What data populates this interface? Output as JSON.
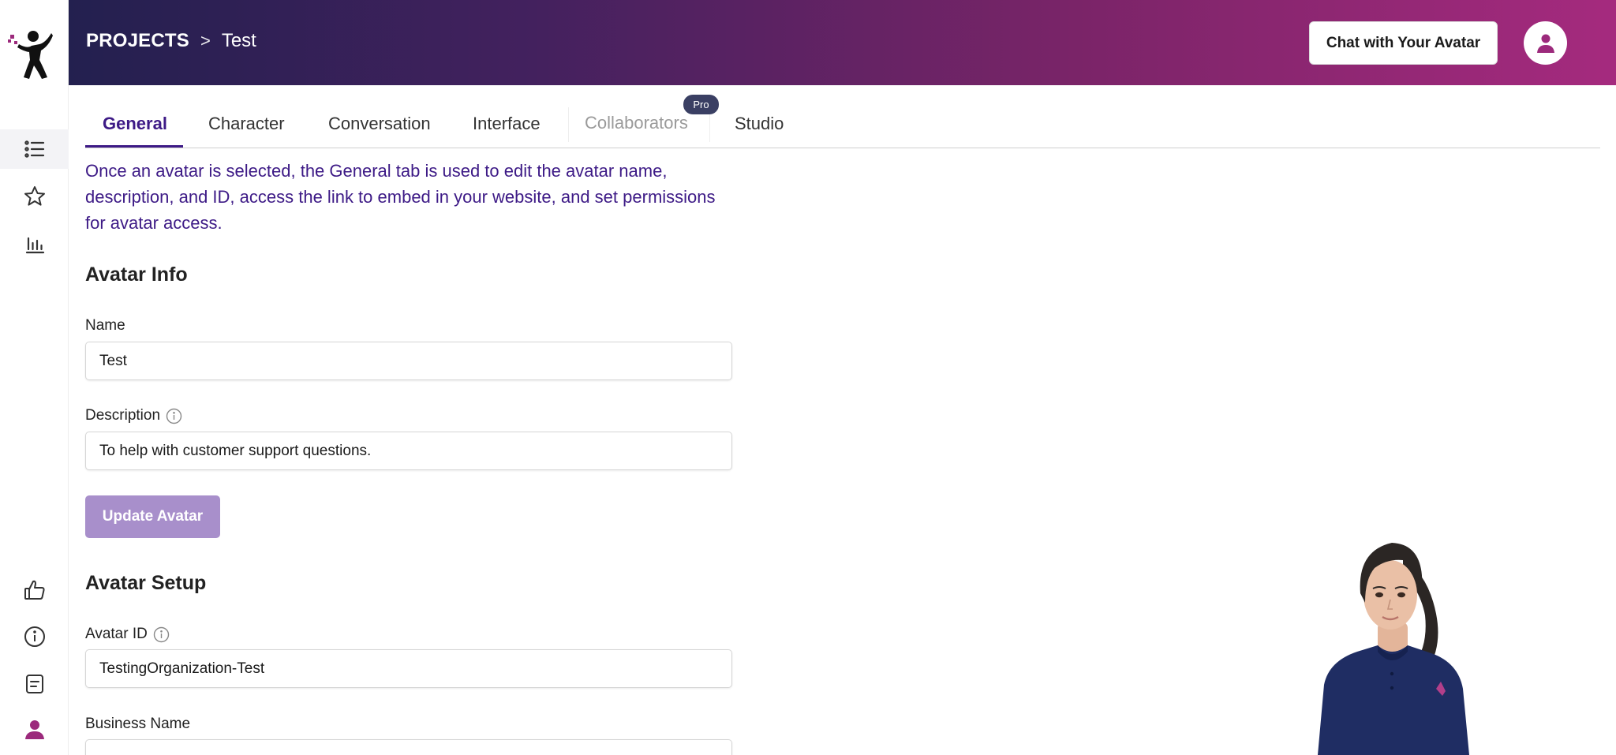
{
  "header": {
    "breadcrumb_root": "PROJECTS",
    "breadcrumb_separator": ">",
    "breadcrumb_current": "Test",
    "chat_button_label": "Chat with Your Avatar",
    "user_icon": "user-icon"
  },
  "sidebar": {
    "top_items": [
      {
        "icon": "list-icon",
        "active": true
      },
      {
        "icon": "star-icon",
        "active": false
      },
      {
        "icon": "bar-chart-icon",
        "active": false
      }
    ],
    "bottom_items": [
      {
        "icon": "thumbs-up-icon"
      },
      {
        "icon": "info-icon"
      },
      {
        "icon": "note-icon"
      },
      {
        "icon": "user-icon"
      }
    ]
  },
  "tabs": [
    {
      "label": "General",
      "active": true
    },
    {
      "label": "Character"
    },
    {
      "label": "Conversation"
    },
    {
      "label": "Interface"
    },
    {
      "label": "Collaborators",
      "disabled": true,
      "badge": "Pro"
    },
    {
      "label": "Studio"
    }
  ],
  "intro_text": "Once an avatar is selected, the General tab is used to edit the avatar name, description, and ID, access the link to embed in your website, and set permissions for avatar access.",
  "avatar_info": {
    "title": "Avatar Info",
    "name_label": "Name",
    "name_value": "Test",
    "description_label": "Description",
    "description_value": "To help with customer support questions.",
    "update_button": "Update Avatar"
  },
  "avatar_setup": {
    "title": "Avatar Setup",
    "avatar_id_label": "Avatar ID",
    "avatar_id_value": "TestingOrganization-Test",
    "business_name_label": "Business Name"
  },
  "colors": {
    "accent": "#3d1a86",
    "header_start": "#23204f",
    "header_end": "#a52a7e",
    "button_disabled": "#a88fcb",
    "brand_pink": "#9c2a7c"
  }
}
